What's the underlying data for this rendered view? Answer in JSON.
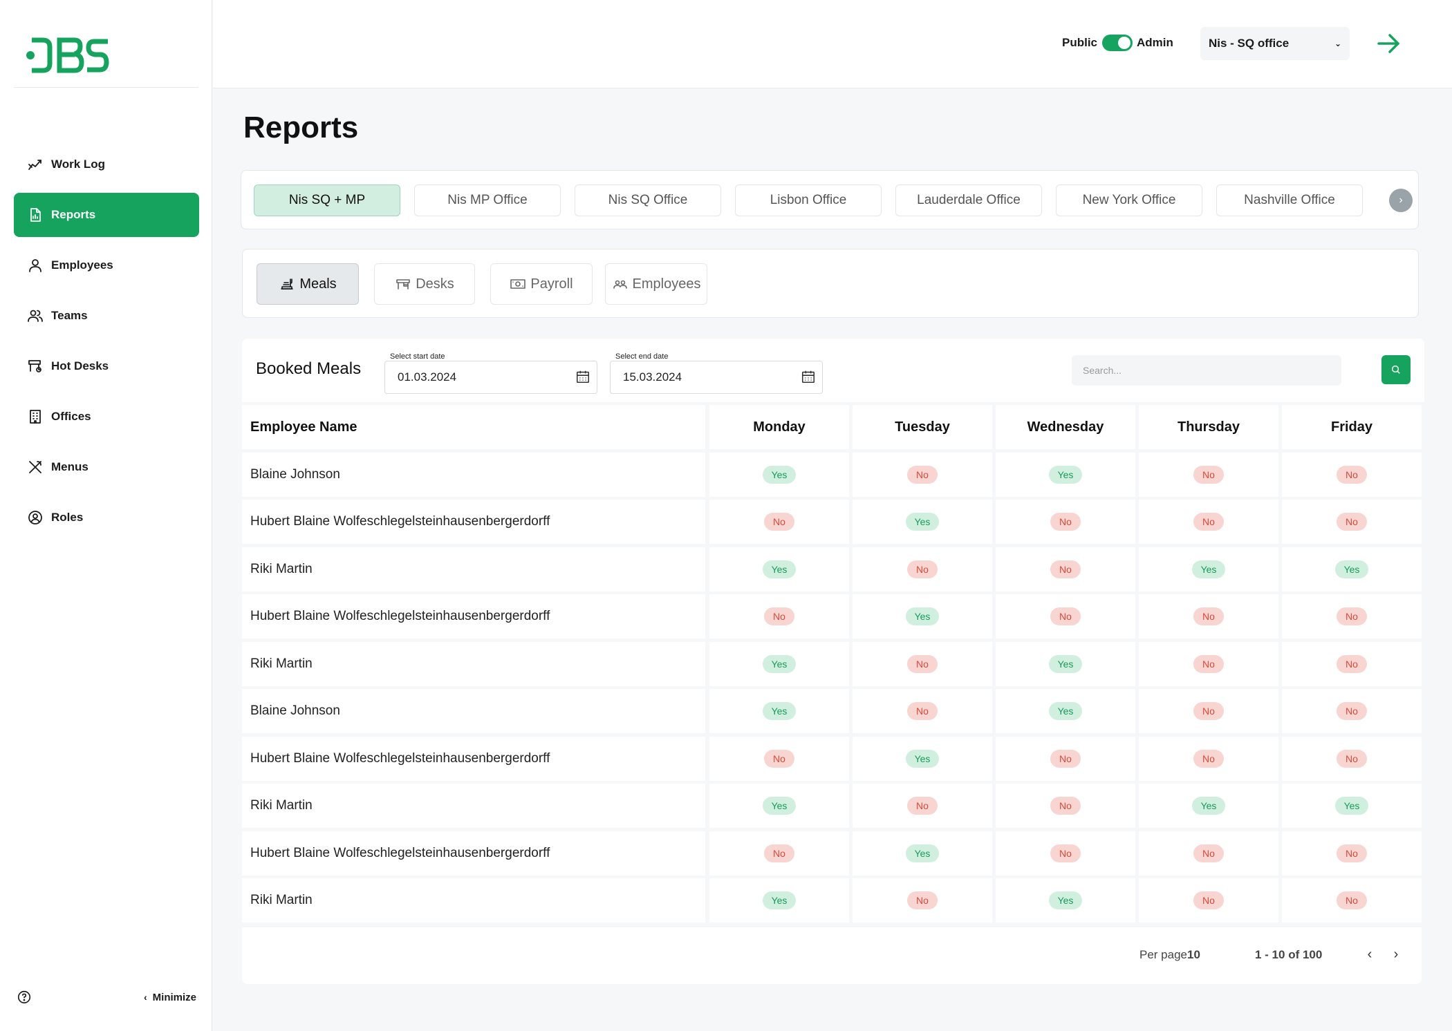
{
  "brand": {
    "logo_text": "DBS",
    "color": "#16a35d"
  },
  "sidebar": {
    "items": [
      {
        "label": "Work Log",
        "icon": "chart-line-icon",
        "active": false
      },
      {
        "label": "Reports",
        "icon": "report-file-icon",
        "active": true
      },
      {
        "label": "Employees",
        "icon": "user-icon",
        "active": false
      },
      {
        "label": "Teams",
        "icon": "users-icon",
        "active": false
      },
      {
        "label": "Hot Desks",
        "icon": "desk-icon",
        "active": false
      },
      {
        "label": "Offices",
        "icon": "building-icon",
        "active": false
      },
      {
        "label": "Menus",
        "icon": "utensils-icon",
        "active": false
      },
      {
        "label": "Roles",
        "icon": "role-icon",
        "active": false
      }
    ],
    "help_icon": "question-circle-icon",
    "minimize_label": "Minimize"
  },
  "topbar": {
    "public_label": "Public",
    "admin_label": "Admin",
    "office_select_value": "Nis - SQ office",
    "logout_icon": "arrow-right-icon"
  },
  "page": {
    "title": "Reports"
  },
  "office_tabs": [
    "Nis SQ + MP",
    "Nis MP Office",
    "Nis SQ Office",
    "Lisbon Office",
    "Lauderdale Office",
    "New York Office",
    "Nashville Office"
  ],
  "report_tabs": [
    {
      "label": "Meals",
      "icon": "meal-icon",
      "active": true
    },
    {
      "label": "Desks",
      "icon": "desk-icon",
      "active": false
    },
    {
      "label": "Payroll",
      "icon": "money-icon",
      "active": false
    },
    {
      "label": "Employees",
      "icon": "users-icon",
      "active": false
    }
  ],
  "booked_meals": {
    "title": "Booked Meals",
    "start_date": {
      "label": "Select start date",
      "value": "01.03.2024"
    },
    "end_date": {
      "label": "Select end date",
      "value": "15.03.2024"
    },
    "search_placeholder": "Search...",
    "columns": [
      "Employee Name",
      "Monday",
      "Tuesday",
      "Wednesday",
      "Thursday",
      "Friday"
    ],
    "rows": [
      {
        "name": "Blaine Johnson",
        "days": [
          "Yes",
          "No",
          "Yes",
          "No",
          "No"
        ]
      },
      {
        "name": "Hubert Blaine Wolfeschlegelsteinhausenbergerdorff",
        "days": [
          "No",
          "Yes",
          "No",
          "No",
          "No"
        ]
      },
      {
        "name": "Riki Martin",
        "days": [
          "Yes",
          "No",
          "No",
          "Yes",
          "Yes"
        ]
      },
      {
        "name": "Hubert Blaine Wolfeschlegelsteinhausenbergerdorff",
        "days": [
          "No",
          "Yes",
          "No",
          "No",
          "No"
        ]
      },
      {
        "name": "Riki Martin",
        "days": [
          "Yes",
          "No",
          "Yes",
          "No",
          "No"
        ]
      },
      {
        "name": "Blaine Johnson",
        "days": [
          "Yes",
          "No",
          "Yes",
          "No",
          "No"
        ]
      },
      {
        "name": "Hubert Blaine Wolfeschlegelsteinhausenbergerdorff",
        "days": [
          "No",
          "Yes",
          "No",
          "No",
          "No"
        ]
      },
      {
        "name": "Riki Martin",
        "days": [
          "Yes",
          "No",
          "No",
          "Yes",
          "Yes"
        ]
      },
      {
        "name": "Hubert Blaine Wolfeschlegelsteinhausenbergerdorff",
        "days": [
          "No",
          "Yes",
          "No",
          "No",
          "No"
        ]
      },
      {
        "name": "Riki Martin",
        "days": [
          "Yes",
          "No",
          "Yes",
          "No",
          "No"
        ]
      }
    ],
    "pagination": {
      "per_page_label": "Per page",
      "per_page_value": "10",
      "range": "1 - 10 of 100"
    }
  }
}
